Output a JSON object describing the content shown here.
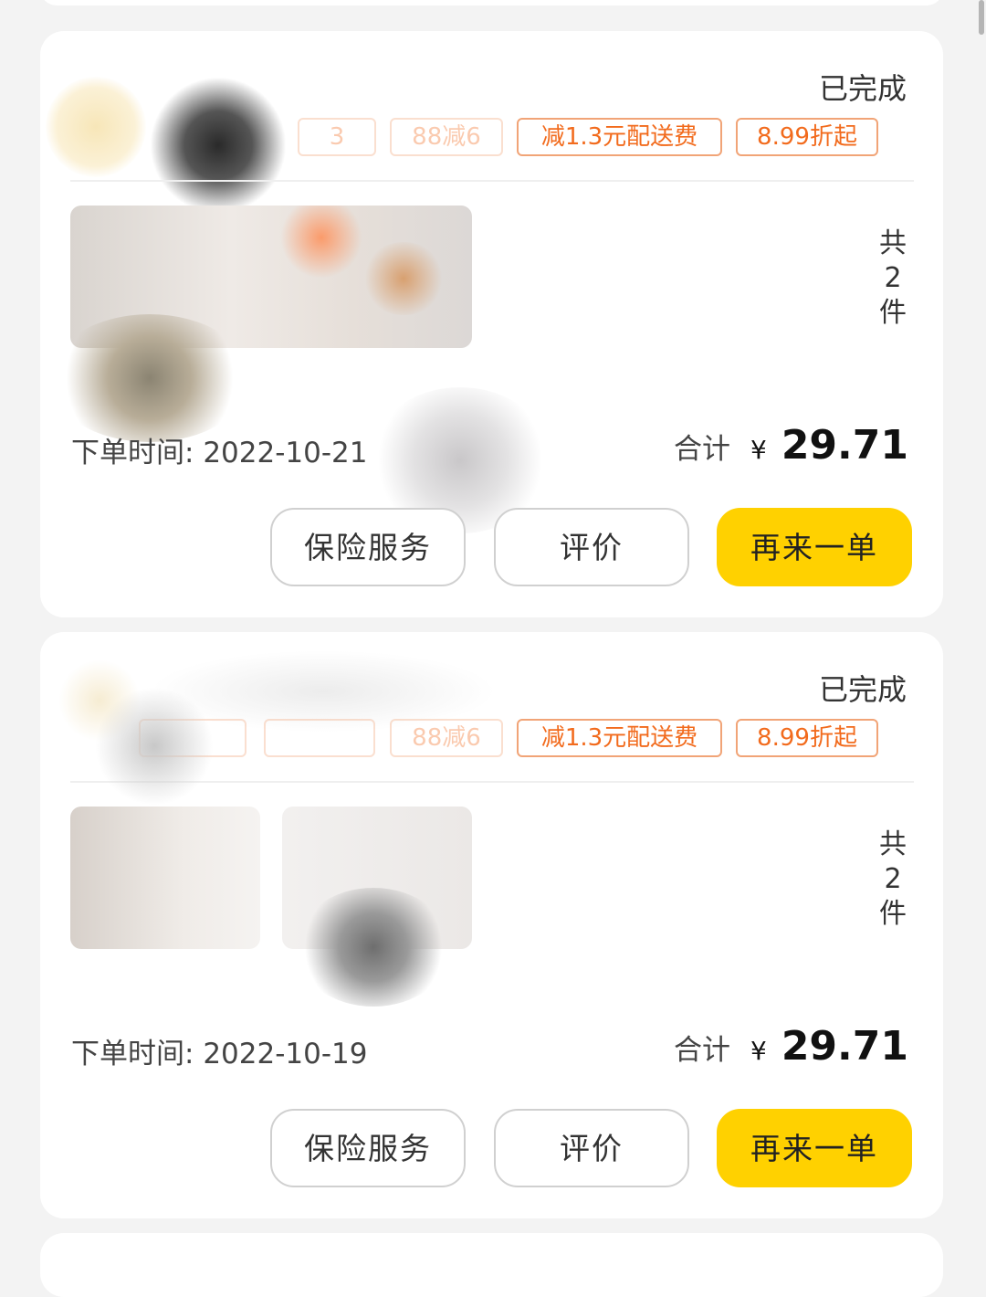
{
  "orders": [
    {
      "status": "已完成",
      "tags": [
        {
          "text": "3",
          "faded": true
        },
        {
          "text": "88减6",
          "faded": true
        },
        {
          "text": "减1.3元配送费",
          "faded": false
        },
        {
          "text": "8.99折起",
          "faded": false
        }
      ],
      "item_count": [
        "共",
        "2",
        "件"
      ],
      "order_time_label": "下单时间:",
      "order_time": "2022-10-21",
      "total_label": "合计",
      "currency": "¥",
      "total": "29.71",
      "buttons": {
        "insurance": "保险服务",
        "review": "评价",
        "reorder": "再来一单"
      }
    },
    {
      "status": "已完成",
      "tags": [
        {
          "text": "",
          "faded": true
        },
        {
          "text": "",
          "faded": true
        },
        {
          "text": "88减6",
          "faded": true
        },
        {
          "text": "减1.3元配送费",
          "faded": false
        },
        {
          "text": "8.99折起",
          "faded": false
        }
      ],
      "item_count": [
        "共",
        "2",
        "件"
      ],
      "order_time_label": "下单时间:",
      "order_time": "2022-10-19",
      "total_label": "合计",
      "currency": "¥",
      "total": "29.71",
      "buttons": {
        "insurance": "保险服务",
        "review": "评价",
        "reorder": "再来一单"
      }
    }
  ],
  "colors": {
    "accent_yellow": "#ffd100",
    "tag_orange": "#f26b1d",
    "page_bg": "#f3f3f3"
  }
}
